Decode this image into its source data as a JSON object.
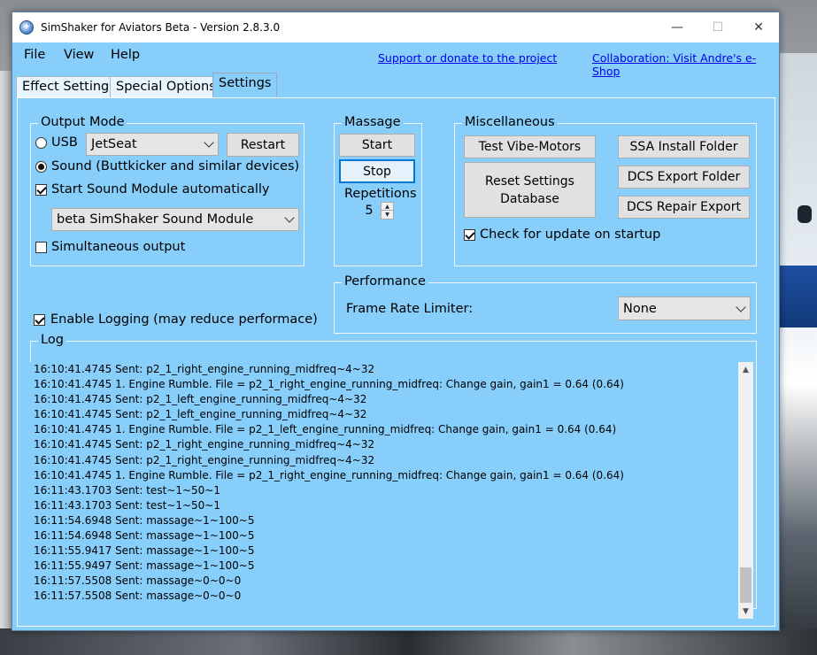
{
  "window": {
    "title": "SimShaker for Aviators Beta  - Version 2.8.3.0",
    "minimize_icon": "minimize-icon",
    "maximize_icon": "maximize-icon",
    "close_icon": "close-icon"
  },
  "menu": {
    "file": "File",
    "view": "View",
    "help": "Help",
    "support_link": "Support or donate to the project",
    "collab_link": "Collaboration: Visit Andre's e-Shop"
  },
  "tabs": [
    {
      "label": "Effect Settings",
      "active": false
    },
    {
      "label": "Special Options",
      "active": false
    },
    {
      "label": "Settings",
      "active": true
    }
  ],
  "output_mode": {
    "title": "Output Mode",
    "usb_label": "USB",
    "usb_device": "JetSeat",
    "restart_label": "Restart",
    "sound_label": "Sound (Buttkicker and similar devices)",
    "start_sound_label": "Start Sound Module automatically",
    "sound_module": "beta SimShaker Sound Module",
    "simultaneous_label": "Simultaneous output",
    "usb_checked": false,
    "sound_checked": true,
    "start_sound_checked": true,
    "simultaneous_checked": false
  },
  "massage": {
    "title": "Massage",
    "start_label": "Start",
    "stop_label": "Stop",
    "repetitions_label": "Repetitions",
    "repetitions_value": "5"
  },
  "misc": {
    "title": "Miscellaneous",
    "test_vibe": "Test Vibe-Motors",
    "ssa_install": "SSA Install Folder",
    "reset_db_line1": "Reset Settings",
    "reset_db_line2": "Database",
    "dcs_export": "DCS Export Folder",
    "dcs_repair": "DCS Repair Export",
    "check_update_label": "Check for update on startup",
    "check_update_checked": true
  },
  "logging": {
    "label": "Enable Logging (may reduce performace)",
    "checked": true
  },
  "performance": {
    "title": "Performance",
    "frame_rate_label": "Frame Rate Limiter:",
    "frame_rate_value": "None"
  },
  "log": {
    "title": "Log",
    "lines": [
      "16:10:41.4745 Sent: p2_1_right_engine_running_midfreq~4~32",
      "16:10:41.4745 1. Engine Rumble. File = p2_1_right_engine_running_midfreq: Change gain, gain1 = 0.64 (0.64)",
      "16:10:41.4745 Sent: p2_1_left_engine_running_midfreq~4~32",
      "16:10:41.4745 Sent: p2_1_left_engine_running_midfreq~4~32",
      "16:10:41.4745 1. Engine Rumble. File = p2_1_left_engine_running_midfreq: Change gain, gain1 = 0.64 (0.64)",
      "16:10:41.4745 Sent: p2_1_right_engine_running_midfreq~4~32",
      "16:10:41.4745 Sent: p2_1_right_engine_running_midfreq~4~32",
      "16:10:41.4745 1. Engine Rumble. File = p2_1_right_engine_running_midfreq: Change gain, gain1 = 0.64 (0.64)",
      "16:11:43.1703 Sent: test~1~50~1",
      "16:11:43.1703 Sent: test~1~50~1",
      "16:11:54.6948 Sent: massage~1~100~5",
      "16:11:54.6948 Sent: massage~1~100~5",
      "16:11:55.9417 Sent: massage~1~100~5",
      "16:11:55.9497 Sent: massage~1~100~5",
      "16:11:57.5508 Sent: massage~0~0~0",
      "16:11:57.5508 Sent: massage~0~0~0"
    ]
  }
}
